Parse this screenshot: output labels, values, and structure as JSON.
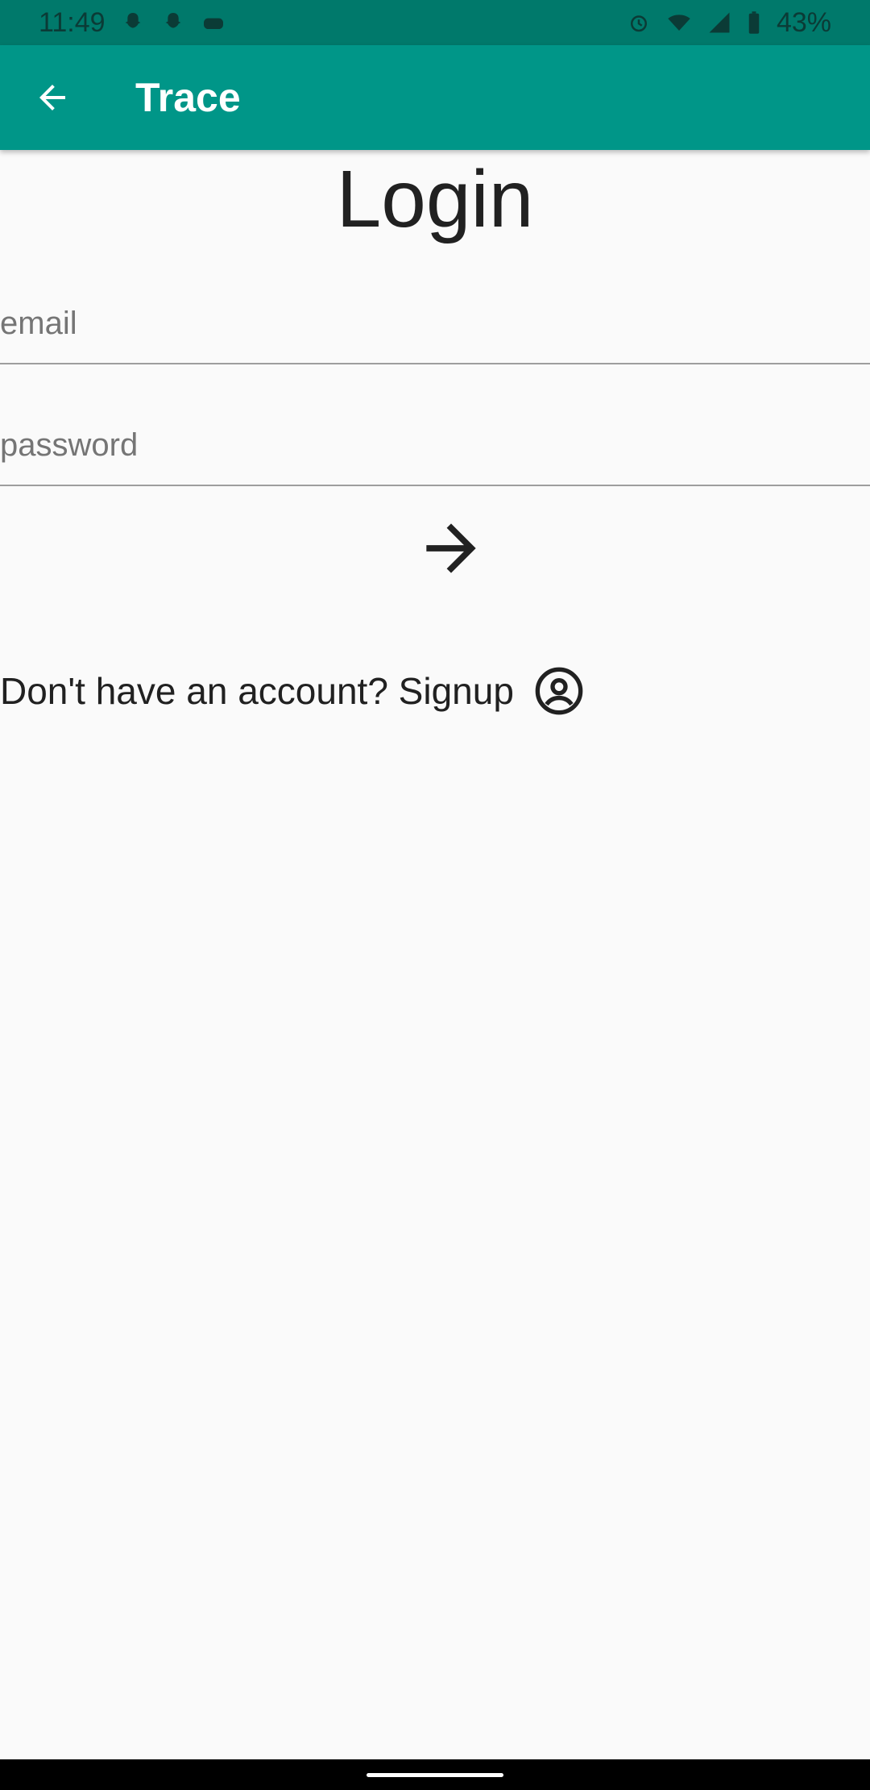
{
  "status_bar": {
    "time": "11:49",
    "battery": "43%",
    "icons": [
      "snapchat-icon",
      "snapchat-icon",
      "game-controller-icon",
      "alarm-icon",
      "wifi-icon",
      "signal-icon",
      "battery-icon"
    ]
  },
  "app_bar": {
    "title": "Trace",
    "back_icon": "back-arrow-icon",
    "background": "#009688"
  },
  "login": {
    "title": "Login",
    "email_placeholder": "email",
    "password_placeholder": "password",
    "submit_icon": "arrow-forward-icon",
    "signup_text": "Don't have an account? Signup",
    "signup_icon": "account-circle-icon"
  }
}
